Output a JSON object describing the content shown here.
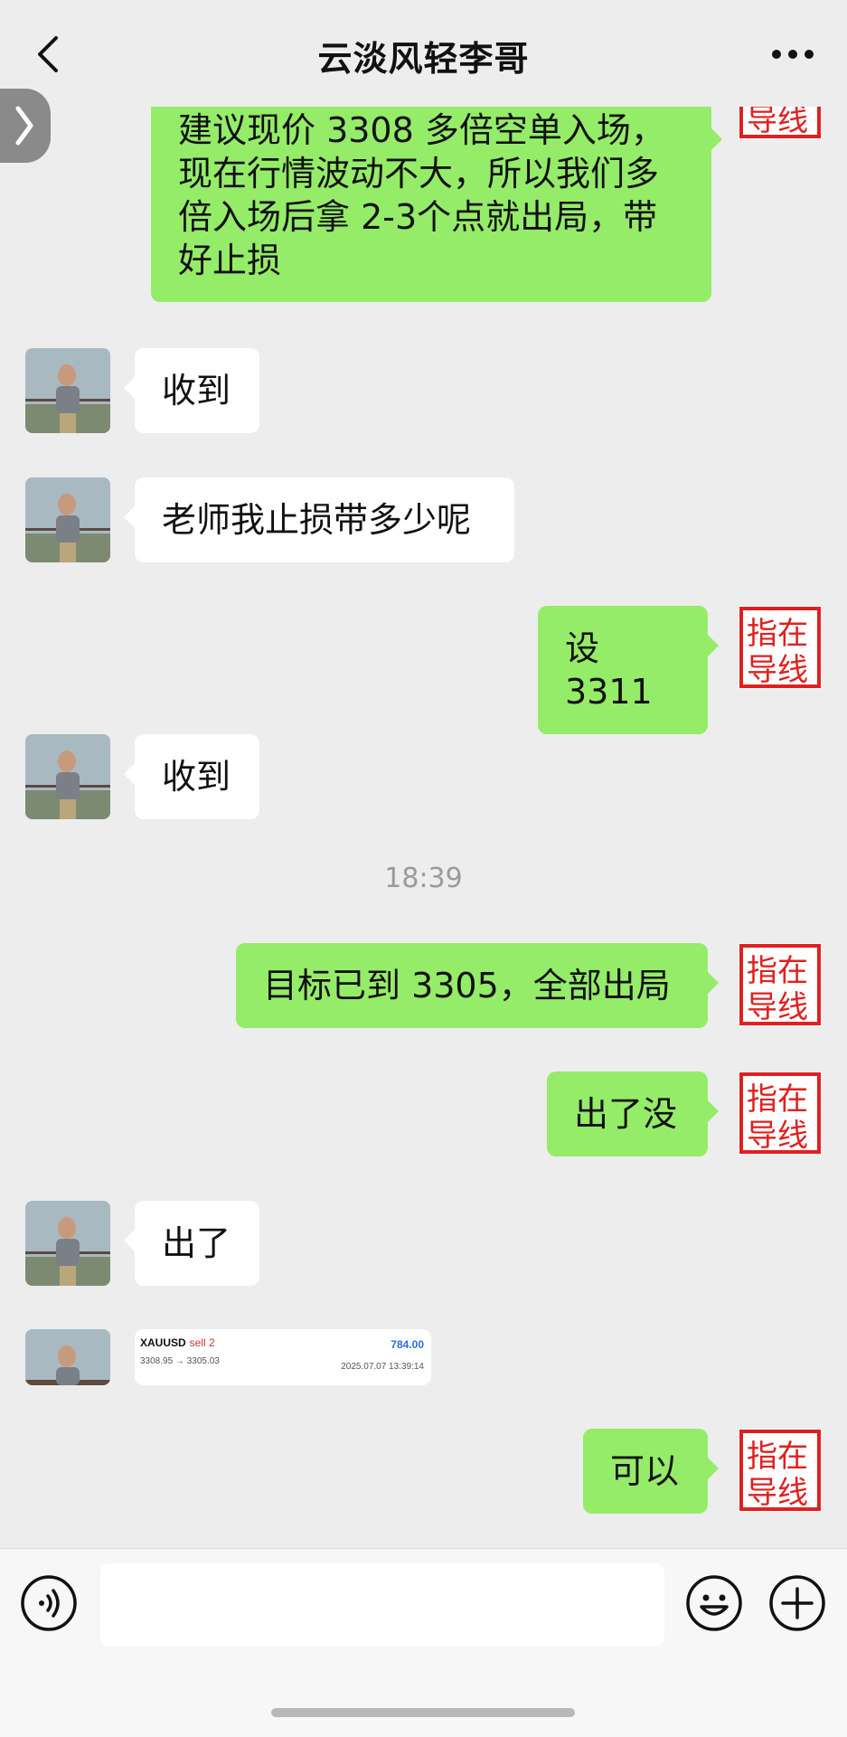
{
  "header": {
    "title": "云淡风轻李哥",
    "back_icon": "chevron-left-icon",
    "more_icon": "more-dots-icon"
  },
  "side_tab_icon": "chevron-right-icon",
  "stamp_text": "指在导线",
  "messages": [
    {
      "side": "out",
      "text": "建议现价 3308 多倍空单入场，现在行情波动不大，所以我们多倍入场后拿 2-3个点就出局，带好止损"
    },
    {
      "side": "in",
      "text": "收到"
    },
    {
      "side": "in",
      "text": "老师我止损带多少呢"
    },
    {
      "side": "out",
      "text": "设 3311"
    },
    {
      "side": "in",
      "text": "收到"
    },
    {
      "side": "time",
      "text": "18:39"
    },
    {
      "side": "out",
      "text": "目标已到 3305，全部出局"
    },
    {
      "side": "out",
      "text": "出了没"
    },
    {
      "side": "in",
      "text": "出了"
    },
    {
      "side": "in",
      "type": "trade-card"
    },
    {
      "side": "out",
      "text": "可以"
    }
  ],
  "trade_card": {
    "symbol": "XAUUSD",
    "side": "sell 2",
    "profit": "784.00",
    "prices": "3308.95 → 3305.03",
    "time": "2025.07.07 13:39:14"
  },
  "input": {
    "value": "",
    "placeholder": ""
  },
  "bottom_icons": [
    "voice-icon",
    "emoji-icon",
    "plus-icon"
  ],
  "colors": {
    "bubble_out": "#95ec69",
    "bubble_in": "#ffffff",
    "background": "#ededed",
    "stamp_red": "#e02020"
  }
}
